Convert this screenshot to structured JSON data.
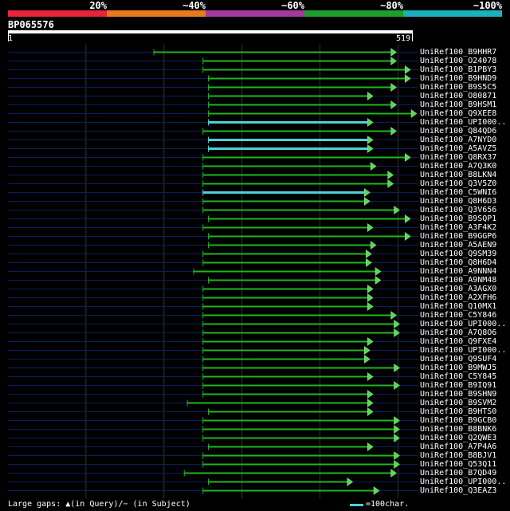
{
  "legend": {
    "labels": [
      "20%",
      "~40%",
      "~60%",
      "~80%",
      "~100%"
    ],
    "colors": [
      "#e8233a",
      "#e87a1e",
      "#a23aa0",
      "#1e9e2a",
      "#1bb0be"
    ]
  },
  "query": {
    "name": "BP065576",
    "start": "1",
    "end": "519",
    "length": 519
  },
  "colors": {
    "hit_green": "#1fb51f",
    "hit_cyan": "#4fd0d8",
    "arrow_green": "#5bd75b",
    "guide_line": "#0c1e5e",
    "grid_line": "#333333"
  },
  "hits": [
    {
      "label": "UniRef100_B9HHR7",
      "start": 187,
      "end": 492,
      "color": "green"
    },
    {
      "label": "UniRef100_O24078",
      "start": 250,
      "end": 492,
      "color": "green"
    },
    {
      "label": "UniRef100_B1PBY3",
      "start": 250,
      "end": 510,
      "color": "green"
    },
    {
      "label": "UniRef100_B9HND9",
      "start": 257,
      "end": 510,
      "color": "green"
    },
    {
      "label": "UniRef100_B9S5C5",
      "start": 257,
      "end": 492,
      "color": "green"
    },
    {
      "label": "UniRef100_O80871",
      "start": 257,
      "end": 462,
      "color": "green"
    },
    {
      "label": "UniRef100_B9HSM1",
      "start": 257,
      "end": 492,
      "color": "green"
    },
    {
      "label": "UniRef100_Q9XEE8",
      "start": 257,
      "end": 518,
      "color": "green"
    },
    {
      "label": "UniRef100_UPI000..",
      "start": 257,
      "end": 462,
      "color": "cyan"
    },
    {
      "label": "UniRef100_Q84QD6",
      "start": 250,
      "end": 492,
      "color": "green"
    },
    {
      "label": "UniRef100_A7NYD0",
      "start": 257,
      "end": 462,
      "color": "cyan"
    },
    {
      "label": "UniRef100_A5AVZ5",
      "start": 257,
      "end": 462,
      "color": "cyan"
    },
    {
      "label": "UniRef100_Q8RX37",
      "start": 250,
      "end": 510,
      "color": "green"
    },
    {
      "label": "UniRef100_A7Q3K0",
      "start": 250,
      "end": 466,
      "color": "green"
    },
    {
      "label": "UniRef100_B8LKN4",
      "start": 250,
      "end": 488,
      "color": "green"
    },
    {
      "label": "UniRef100_Q3V5Z0",
      "start": 250,
      "end": 488,
      "color": "green"
    },
    {
      "label": "UniRef100_C5WNI6",
      "start": 250,
      "end": 458,
      "color": "cyan"
    },
    {
      "label": "UniRef100_Q8H6D3",
      "start": 250,
      "end": 458,
      "color": "green"
    },
    {
      "label": "UniRef100_Q3V656",
      "start": 250,
      "end": 496,
      "color": "green"
    },
    {
      "label": "UniRef100_B9SQP1",
      "start": 257,
      "end": 510,
      "color": "green"
    },
    {
      "label": "UniRef100_A3F4K2",
      "start": 250,
      "end": 462,
      "color": "green"
    },
    {
      "label": "UniRef100_B9GGP6",
      "start": 257,
      "end": 510,
      "color": "green"
    },
    {
      "label": "UniRef100_A5AEN9",
      "start": 257,
      "end": 466,
      "color": "green"
    },
    {
      "label": "UniRef100_Q9SM39",
      "start": 250,
      "end": 460,
      "color": "green"
    },
    {
      "label": "UniRef100_Q8H6D4",
      "start": 250,
      "end": 460,
      "color": "green"
    },
    {
      "label": "UniRef100_A9NNN4",
      "start": 238,
      "end": 472,
      "color": "green"
    },
    {
      "label": "UniRef100_A9NM48",
      "start": 257,
      "end": 472,
      "color": "green"
    },
    {
      "label": "UniRef100_A3AGX0",
      "start": 250,
      "end": 462,
      "color": "green"
    },
    {
      "label": "UniRef100_A2XFH6",
      "start": 250,
      "end": 462,
      "color": "green"
    },
    {
      "label": "UniRef100_Q10MX1",
      "start": 250,
      "end": 462,
      "color": "green"
    },
    {
      "label": "UniRef100_C5Y846",
      "start": 250,
      "end": 492,
      "color": "green"
    },
    {
      "label": "UniRef100_UPI000..",
      "start": 250,
      "end": 496,
      "color": "green"
    },
    {
      "label": "UniRef100_A7Q8O6",
      "start": 250,
      "end": 496,
      "color": "green"
    },
    {
      "label": "UniRef100_Q9FXE4",
      "start": 250,
      "end": 462,
      "color": "green"
    },
    {
      "label": "UniRef100_UPI000..",
      "start": 250,
      "end": 458,
      "color": "green"
    },
    {
      "label": "UniRef100_Q9SUF4",
      "start": 250,
      "end": 458,
      "color": "green"
    },
    {
      "label": "UniRef100_B9MWJ5",
      "start": 250,
      "end": 496,
      "color": "green"
    },
    {
      "label": "UniRef100_C5Y845",
      "start": 250,
      "end": 462,
      "color": "green"
    },
    {
      "label": "UniRef100_B9IQ91",
      "start": 250,
      "end": 496,
      "color": "green"
    },
    {
      "label": "UniRef100_B9SHN9",
      "start": 250,
      "end": 462,
      "color": "green"
    },
    {
      "label": "UniRef100_B9SVM2",
      "start": 230,
      "end": 462,
      "color": "green"
    },
    {
      "label": "UniRef100_B9HTS0",
      "start": 257,
      "end": 462,
      "color": "green"
    },
    {
      "label": "UniRef100_B9GCB0",
      "start": 250,
      "end": 496,
      "color": "green"
    },
    {
      "label": "UniRef100_B8BNK6",
      "start": 250,
      "end": 496,
      "color": "green"
    },
    {
      "label": "UniRef100_Q2QWE3",
      "start": 250,
      "end": 496,
      "color": "green"
    },
    {
      "label": "UniRef100_A7P4A6",
      "start": 257,
      "end": 462,
      "color": "green"
    },
    {
      "label": "UniRef100_B8BJV1",
      "start": 250,
      "end": 496,
      "color": "green"
    },
    {
      "label": "UniRef100_Q53Q11",
      "start": 250,
      "end": 496,
      "color": "green"
    },
    {
      "label": "UniRef100_B7QD49",
      "start": 226,
      "end": 492,
      "color": "green"
    },
    {
      "label": "UniRef100_UPI000..",
      "start": 257,
      "end": 436,
      "color": "green"
    },
    {
      "label": "UniRef100_Q3EAZ3",
      "start": 250,
      "end": 470,
      "color": "green"
    }
  ],
  "footer": {
    "gap_text": "Large gaps: ▲(in Query)/− (in Subject)",
    "scale_text": "=100char."
  }
}
